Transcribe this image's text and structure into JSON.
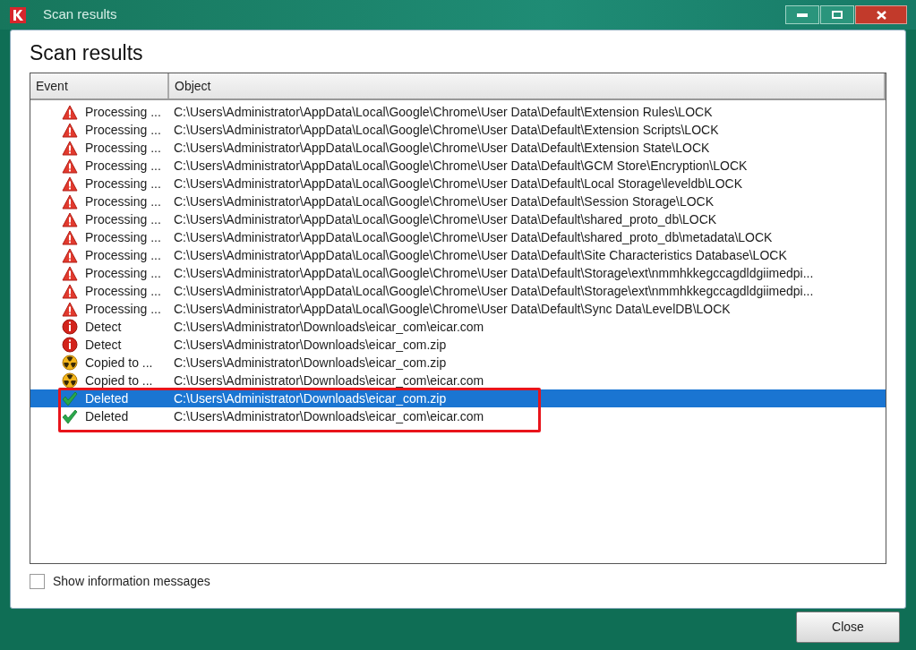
{
  "window": {
    "title": "Scan results"
  },
  "heading": "Scan results",
  "table": {
    "columns": [
      "Event",
      "Object"
    ],
    "rows": [
      {
        "kind": "warning",
        "event": "Processing ...",
        "object": "C:\\Users\\Administrator\\AppData\\Local\\Google\\Chrome\\User Data\\Default\\Extension Rules\\LOCK",
        "selected": false
      },
      {
        "kind": "warning",
        "event": "Processing ...",
        "object": "C:\\Users\\Administrator\\AppData\\Local\\Google\\Chrome\\User Data\\Default\\Extension Scripts\\LOCK",
        "selected": false
      },
      {
        "kind": "warning",
        "event": "Processing ...",
        "object": "C:\\Users\\Administrator\\AppData\\Local\\Google\\Chrome\\User Data\\Default\\Extension State\\LOCK",
        "selected": false
      },
      {
        "kind": "warning",
        "event": "Processing ...",
        "object": "C:\\Users\\Administrator\\AppData\\Local\\Google\\Chrome\\User Data\\Default\\GCM Store\\Encryption\\LOCK",
        "selected": false
      },
      {
        "kind": "warning",
        "event": "Processing ...",
        "object": "C:\\Users\\Administrator\\AppData\\Local\\Google\\Chrome\\User Data\\Default\\Local Storage\\leveldb\\LOCK",
        "selected": false
      },
      {
        "kind": "warning",
        "event": "Processing ...",
        "object": "C:\\Users\\Administrator\\AppData\\Local\\Google\\Chrome\\User Data\\Default\\Session Storage\\LOCK",
        "selected": false
      },
      {
        "kind": "warning",
        "event": "Processing ...",
        "object": "C:\\Users\\Administrator\\AppData\\Local\\Google\\Chrome\\User Data\\Default\\shared_proto_db\\LOCK",
        "selected": false
      },
      {
        "kind": "warning",
        "event": "Processing ...",
        "object": "C:\\Users\\Administrator\\AppData\\Local\\Google\\Chrome\\User Data\\Default\\shared_proto_db\\metadata\\LOCK",
        "selected": false
      },
      {
        "kind": "warning",
        "event": "Processing ...",
        "object": "C:\\Users\\Administrator\\AppData\\Local\\Google\\Chrome\\User Data\\Default\\Site Characteristics Database\\LOCK",
        "selected": false
      },
      {
        "kind": "warning",
        "event": "Processing ...",
        "object": "C:\\Users\\Administrator\\AppData\\Local\\Google\\Chrome\\User Data\\Default\\Storage\\ext\\nmmhkkegccagdldgiimedpi...",
        "selected": false
      },
      {
        "kind": "warning",
        "event": "Processing ...",
        "object": "C:\\Users\\Administrator\\AppData\\Local\\Google\\Chrome\\User Data\\Default\\Storage\\ext\\nmmhkkegccagdldgiimedpi...",
        "selected": false
      },
      {
        "kind": "warning",
        "event": "Processing ...",
        "object": "C:\\Users\\Administrator\\AppData\\Local\\Google\\Chrome\\User Data\\Default\\Sync Data\\LevelDB\\LOCK",
        "selected": false
      },
      {
        "kind": "detect",
        "event": "Detect",
        "object": "C:\\Users\\Administrator\\Downloads\\eicar_com\\eicar.com",
        "selected": false
      },
      {
        "kind": "detect",
        "event": "Detect",
        "object": "C:\\Users\\Administrator\\Downloads\\eicar_com.zip",
        "selected": false
      },
      {
        "kind": "quarantine",
        "event": "Copied to ...",
        "object": "C:\\Users\\Administrator\\Downloads\\eicar_com.zip",
        "selected": false
      },
      {
        "kind": "quarantine",
        "event": "Copied to ...",
        "object": "C:\\Users\\Administrator\\Downloads\\eicar_com\\eicar.com",
        "selected": false
      },
      {
        "kind": "deleted",
        "event": "Deleted",
        "object": "C:\\Users\\Administrator\\Downloads\\eicar_com.zip",
        "selected": true
      },
      {
        "kind": "deleted",
        "event": "Deleted",
        "object": "C:\\Users\\Administrator\\Downloads\\eicar_com\\eicar.com",
        "selected": false
      }
    ]
  },
  "show_info_messages": {
    "label": "Show information messages",
    "checked": false
  },
  "buttons": [
    "Close"
  ]
}
